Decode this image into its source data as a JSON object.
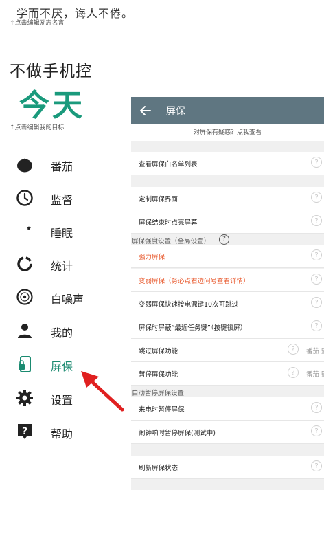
{
  "drawer": {
    "motto": "学而不厌，诲人不倦。",
    "motto_hint": "↑点击编辑励志名言",
    "app_title": "不做手机控",
    "today": "今天",
    "goal_hint": "↑点击编辑我的目标",
    "items": [
      {
        "label": "番茄",
        "icon": "tomato-icon"
      },
      {
        "label": "监督",
        "icon": "clock-icon"
      },
      {
        "label": "睡眠",
        "icon": "moon-star-icon"
      },
      {
        "label": "统计",
        "icon": "ring-chart-icon"
      },
      {
        "label": "白噪声",
        "icon": "disc-icon"
      },
      {
        "label": "我的",
        "icon": "person-icon"
      },
      {
        "label": "屏保",
        "icon": "phone-lock-icon"
      },
      {
        "label": "设置",
        "icon": "gear-icon"
      },
      {
        "label": "帮助",
        "icon": "help-icon"
      }
    ],
    "active_color": "#1a8a70"
  },
  "panel": {
    "title": "屏保",
    "faq": "对屏保有疑惑？点我查看",
    "rows": {
      "whitelist": "查看屏保白名单列表",
      "customize": "定制屏保界面",
      "screen_on_end": "屏保结束时点亮屏幕",
      "strong": "强力屏保",
      "weak": "变弱屏保（务必点右边问号查看详情）",
      "weak_skip": "变弱屏保快速按电源键10次可跳过",
      "hide_recents": "屏保时屏蔽“最近任务键”（按键锁屏）",
      "skip_func": "跳过屏保功能",
      "skip_value": "番茄 監",
      "pause_func": "暂停屏保功能",
      "pause_value": "番茄 監",
      "incoming_call": "来电时暂停屏保",
      "alarm": "闹钟响时暂停屏保(测试中)",
      "refresh": "刷新屏保状态"
    },
    "sections": {
      "strength": "屏保强度设置（全局设置）",
      "auto_pause": "自动暂停屏保设置"
    },
    "help_glyph": "?",
    "toolbar_color": "#5f7681",
    "warning_color": "#e8582c"
  }
}
